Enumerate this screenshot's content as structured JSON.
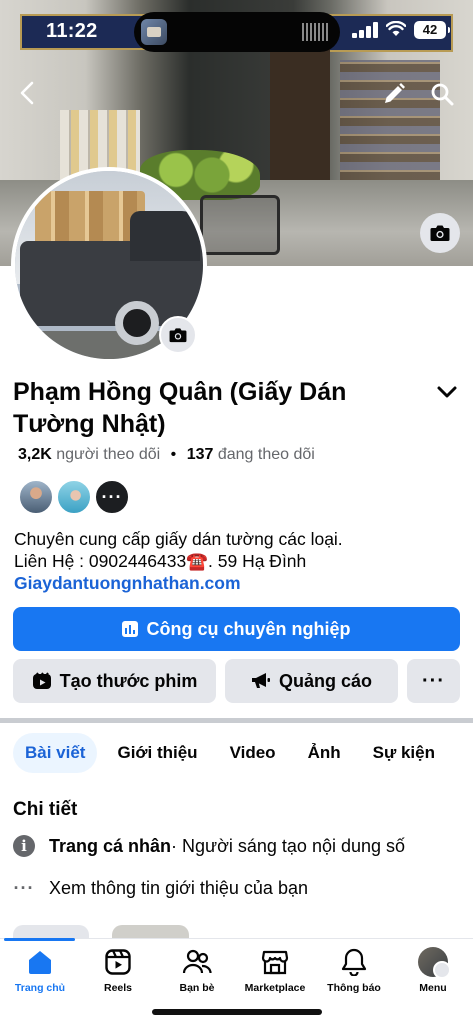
{
  "status_bar": {
    "time": "11:22",
    "battery": "42"
  },
  "profile": {
    "name": "Phạm Hồng Quân (Giấy Dán Tường Nhật)",
    "followers_count": "3,2K",
    "followers_label": "người theo dõi",
    "following_count": "137",
    "following_label": "đang theo dõi",
    "bio_line1": "Chuyên cung cấp giấy dán tường các loại.",
    "bio_line2": "Liên Hệ : 0902446433☎️. 59 Hạ Đình",
    "website": "Giaydantuongnhathan.com"
  },
  "actions": {
    "professional_tools": "Công cụ chuyên nghiệp",
    "create_reel": "Tạo thước phim",
    "ads": "Quảng cáo",
    "more": "···"
  },
  "tabs": [
    {
      "label": "Bài viết",
      "active": true
    },
    {
      "label": "Giới thiệu",
      "active": false
    },
    {
      "label": "Video",
      "active": false
    },
    {
      "label": "Ảnh",
      "active": false
    },
    {
      "label": "Sự kiện",
      "active": false
    }
  ],
  "details": {
    "title": "Chi tiết",
    "profile_type_label": "Trang cá nhân",
    "profile_type_value": " · Người sáng tạo nội dung số",
    "see_intro": "Xem thông tin giới thiệu của bạn"
  },
  "friends_more": "···",
  "bottom_nav": [
    {
      "label": "Trang chủ",
      "icon": "home-icon",
      "active": true
    },
    {
      "label": "Reels",
      "icon": "reels-icon",
      "active": false
    },
    {
      "label": "Bạn bè",
      "icon": "friends-icon",
      "active": false
    },
    {
      "label": "Marketplace",
      "icon": "marketplace-icon",
      "active": false
    },
    {
      "label": "Thông báo",
      "icon": "bell-icon",
      "active": false
    },
    {
      "label": "Menu",
      "icon": "menu-avatar",
      "active": false
    }
  ],
  "colors": {
    "accent": "#1877f2",
    "link": "#1b63d6",
    "button_gray": "#e4e6eb",
    "tab_active_bg": "#ebf5ff"
  }
}
